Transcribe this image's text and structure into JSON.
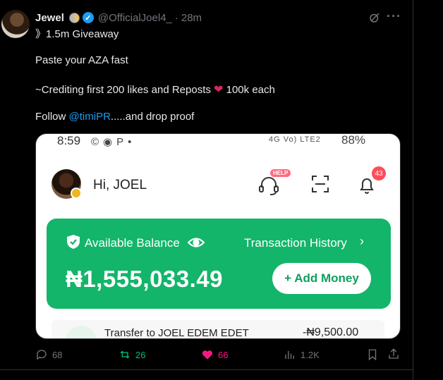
{
  "post": {
    "author_name": "Jewel",
    "handle": "@OfficialJoel4_",
    "separator": "·",
    "time": "28m",
    "lines": {
      "line1": "》1.5m Giveaway",
      "line2": "Paste your AZA fast",
      "line3_before": "~Crediting first 200 likes and Reposts ",
      "line3_after": " 100k each",
      "line4_before": "Follow ",
      "line4_mention": "@timiPR",
      "line4_after": ".....and drop proof"
    },
    "heart_emoji": "❤"
  },
  "media": {
    "status_bar": {
      "time": "8:59",
      "network": "4G Vo) LTE2",
      "battery": "88%"
    },
    "greeting": "Hi, JOEL",
    "help_badge": "HELP",
    "bell_count": "43",
    "balance_card": {
      "available_label": "Available Balance",
      "transaction_history": "Transaction History",
      "chevron": "›",
      "amount": "₦1,555,033.49",
      "add_money": "+ Add Money"
    },
    "transaction": {
      "title": "Transfer to JOEL EDEM EDET",
      "amount": "-₦9,500.00"
    },
    "colors": {
      "card_green": "#13b56a",
      "badge_red": "#ff4d5a"
    }
  },
  "actions": {
    "replies": "68",
    "reposts": "26",
    "likes": "66",
    "views": "1.2K"
  },
  "icons": [
    "verified-icon",
    "grok-icon",
    "more-icon",
    "reply-icon",
    "repost-icon",
    "like-icon",
    "views-icon",
    "bookmark-icon",
    "share-icon"
  ],
  "colors": {
    "accent_blue": "#1d9bf0",
    "repost_green": "#00ba7c",
    "like_pink": "#f91880",
    "muted": "#71767b"
  }
}
